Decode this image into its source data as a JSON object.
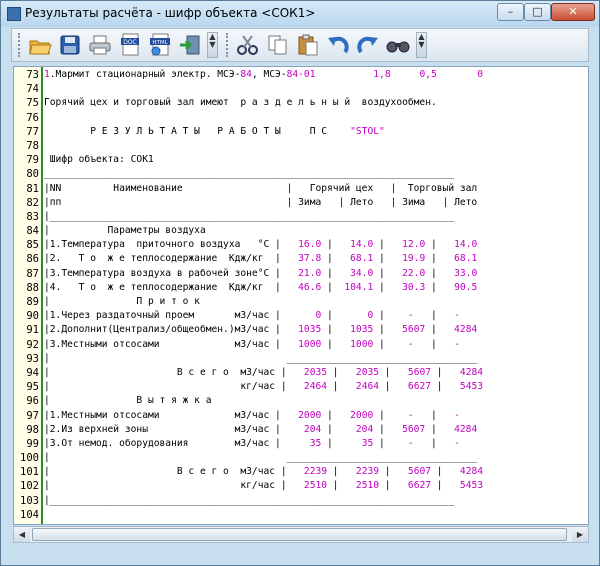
{
  "window": {
    "title": "Результаты расчёта - шифр объекта <СОК1>"
  },
  "toolbar": {
    "buttons": [
      {
        "name": "open-folder-icon",
        "label": "Open"
      },
      {
        "name": "save-icon",
        "label": "Save"
      },
      {
        "name": "print-icon",
        "label": "Print"
      },
      {
        "name": "doc-export-icon",
        "label": "DOC"
      },
      {
        "name": "html-export-icon",
        "label": "HTML"
      },
      {
        "name": "exit-icon",
        "label": "Exit"
      },
      {
        "name": "cut-icon",
        "label": "Cut"
      },
      {
        "name": "copy-icon",
        "label": "Copy"
      },
      {
        "name": "paste-icon",
        "label": "Paste"
      },
      {
        "name": "undo-icon",
        "label": "Undo"
      },
      {
        "name": "redo-icon",
        "label": "Redo"
      },
      {
        "name": "find-icon",
        "label": "Find"
      }
    ],
    "doc_label": "DOC",
    "html_label": "HTML"
  },
  "lines": [
    {
      "n": "73",
      "t": "1.Мармит стационарный электр. МСЭ-84, МСЭ-84-01          1,8     0,5       0"
    },
    {
      "n": "74",
      "t": ""
    },
    {
      "n": "75",
      "t": "Горячий цех и торговый зал имеют  р а з д е л ь н ы й  воздухообмен."
    },
    {
      "n": "76",
      "t": ""
    },
    {
      "n": "77",
      "t": "        Р Е З У Л Ь Т А Т Ы   Р А Б О Т Ы     П С    \"STOL\""
    },
    {
      "n": "78",
      "t": ""
    },
    {
      "n": "79",
      "t": " Шифр объекта: СОК1"
    },
    {
      "n": "80",
      "t": "_______________________________________________________________________"
    },
    {
      "n": "81",
      "t": "|NN         Наименование                  |   Горячий цех   |  Торговый зал"
    },
    {
      "n": "82",
      "t": "|пп                                       | Зима   | Лето   | Зима   | Лето"
    },
    {
      "n": "83",
      "t": "|______________________________________________________________________"
    },
    {
      "n": "84",
      "t": "|          Параметры воздуха"
    },
    {
      "n": "85",
      "t": "|1.Температура  приточного воздуха   °С |   16.0 |   14.0 |   12.0 |   14.0"
    },
    {
      "n": "86",
      "t": "|2.   Т о  ж е теплосодержание  Кдж/кг  |   37.8 |   68.1 |   19.9 |   68.1"
    },
    {
      "n": "87",
      "t": "|3.Температура воздуха в рабочей зоне°С |   21.0 |   34.0 |   22.0 |   33.0"
    },
    {
      "n": "88",
      "t": "|4.   Т о  ж е теплосодержание  Кдж/кг  |   46.6 |  104.1 |   30.3 |   90.5"
    },
    {
      "n": "89",
      "t": "|               П р и т о к"
    },
    {
      "n": "90",
      "t": "|1.Через раздаточный проем       м3/час |      0 |      0 |    -   |   -"
    },
    {
      "n": "91",
      "t": "|2.Дополнит(Централиз/общеобмен.)м3/час |   1035 |   1035 |   5607 |   4284"
    },
    {
      "n": "92",
      "t": "|3.Местными отсосами             м3/час |   1000 |   1000 |    -   |   -"
    },
    {
      "n": "93",
      "t": "|                                         _________________________________"
    },
    {
      "n": "94",
      "t": "|                      В с е г о  м3/час |   2035 |   2035 |   5607 |   4284"
    },
    {
      "n": "95",
      "t": "|                                 кг/час |   2464 |   2464 |   6627 |   5453"
    },
    {
      "n": "96",
      "t": "|               В ы т я ж к а"
    },
    {
      "n": "97",
      "t": "|1.Местными отсосами             м3/час |   2000 |   2000 |    -   |   -"
    },
    {
      "n": "98",
      "t": "|2.Из верхней зоны               м3/час |    204 |    204 |   5607 |   4284"
    },
    {
      "n": "99",
      "t": "|3.От немод. оборудования        м3/час |     35 |     35 |    -   |   -"
    },
    {
      "n": "100",
      "t": "|                                         _________________________________"
    },
    {
      "n": "101",
      "t": "|                      В с е г о  м3/час |   2239 |   2239 |   5607 |   4284"
    },
    {
      "n": "102",
      "t": "|                                 кг/час |   2510 |   2510 |   6627 |   5453"
    },
    {
      "n": "103",
      "t": "|______________________________________________________________________"
    },
    {
      "n": "104",
      "t": ""
    }
  ],
  "colors": {
    "value": "#c000c0",
    "gutter_bg": "#ffffe8",
    "gutter_border": "#2c8a2c"
  }
}
